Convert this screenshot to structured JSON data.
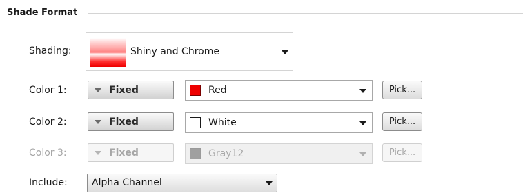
{
  "section": {
    "title": "Shade Format"
  },
  "shading": {
    "label": "Shading:",
    "value": "Shiny and Chrome",
    "swatch_colors": [
      "#ffffff",
      "#ff7f7f",
      "#ee0000"
    ]
  },
  "color1": {
    "label": "Color 1:",
    "mode": "Fixed",
    "color_name": "Red",
    "swatch_color": "#ee0000",
    "pick_label": "Pick..."
  },
  "color2": {
    "label": "Color 2:",
    "mode": "Fixed",
    "color_name": "White",
    "swatch_color": "#ffffff",
    "pick_label": "Pick..."
  },
  "color3": {
    "label": "Color 3:",
    "mode": "Fixed",
    "color_name": "Gray12",
    "swatch_color": "#a0a0a0",
    "pick_label": "Pick...",
    "disabled": true
  },
  "include": {
    "label": "Include:",
    "value": "Alpha Channel"
  }
}
